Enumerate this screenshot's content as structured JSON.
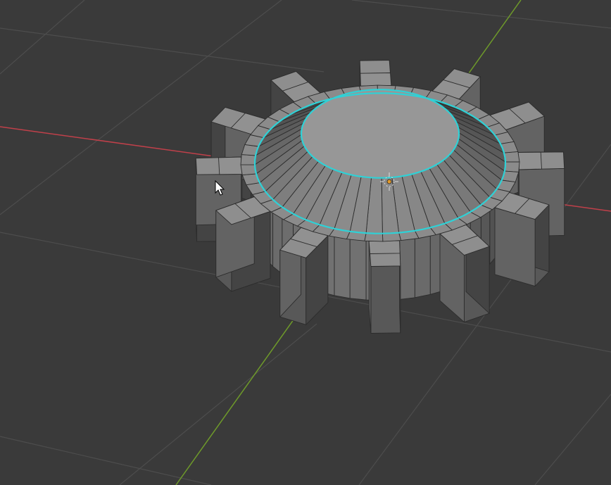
{
  "viewport": {
    "background": "#3a3a3a",
    "grid_color": "#4d4d4d",
    "x_axis_color": "#c0404a",
    "y_axis_color": "#6e9a2a"
  },
  "mesh": {
    "object": "gear",
    "tooth_count": 12,
    "face_color": "#8e8e8e",
    "edge_color": "#2c2c2c",
    "selection_color": "#2fd1d6"
  },
  "overlays": {
    "origin_marker": "object-origin-icon",
    "origin_color": "#e39a2a",
    "cursor": "mouse-pointer-icon"
  }
}
